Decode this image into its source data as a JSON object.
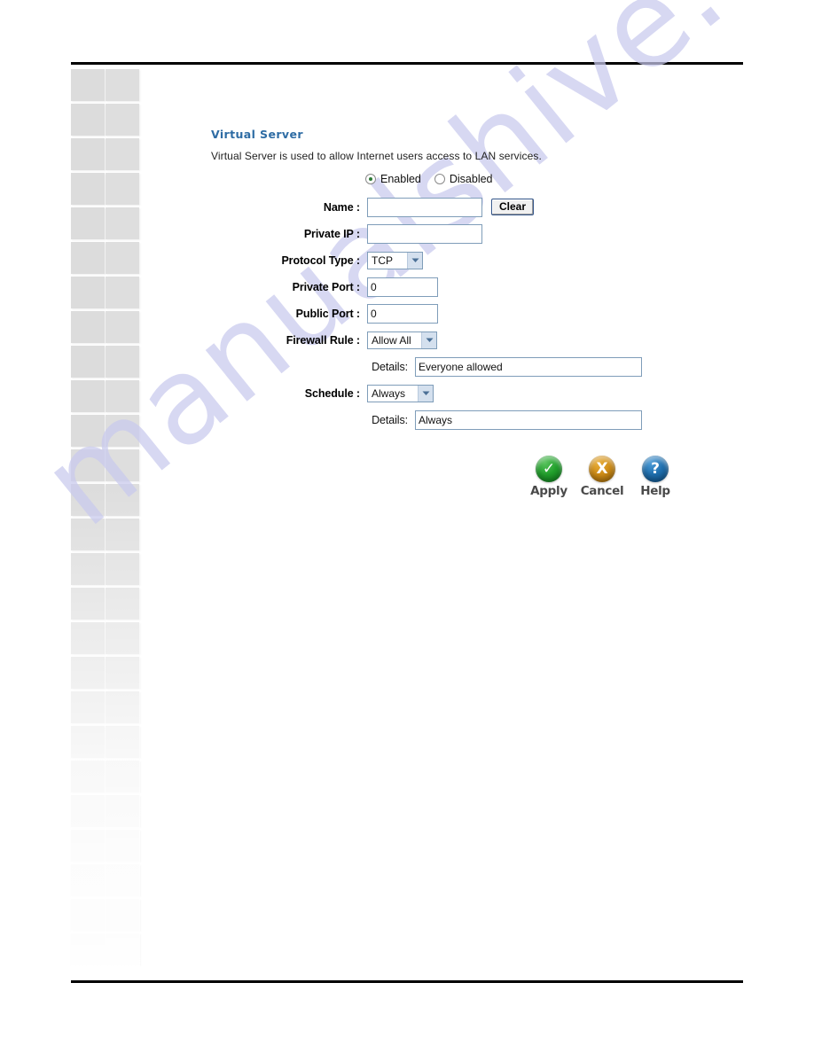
{
  "panel": {
    "title": "Virtual Server",
    "description": "Virtual Server is used to allow Internet users access to LAN services."
  },
  "enable": {
    "enabled_label": "Enabled",
    "disabled_label": "Disabled",
    "selected": "Enabled"
  },
  "fields": {
    "name": {
      "label": "Name :",
      "value": "",
      "clear_label": "Clear"
    },
    "private_ip": {
      "label": "Private IP :",
      "value": ""
    },
    "protocol_type": {
      "label": "Protocol Type :",
      "value": "TCP"
    },
    "private_port": {
      "label": "Private Port :",
      "value": "0"
    },
    "public_port": {
      "label": "Public Port :",
      "value": "0"
    },
    "firewall_rule": {
      "label": "Firewall Rule :",
      "value": "Allow All",
      "details_label": "Details:",
      "details_value": "Everyone allowed"
    },
    "schedule": {
      "label": "Schedule :",
      "value": "Always",
      "details_label": "Details:",
      "details_value": "Always"
    }
  },
  "actions": {
    "apply": {
      "label": "Apply",
      "glyph": "✓",
      "color": "#22a02c"
    },
    "cancel": {
      "label": "Cancel",
      "glyph": "X",
      "color": "#cf8c16"
    },
    "help": {
      "label": "Help",
      "glyph": "?",
      "color": "#1f6fae"
    }
  },
  "watermark": {
    "text": "manualshive.com",
    "color": "#c9caee"
  },
  "colors": {
    "heading": "#2e6ca4",
    "input_border": "#7f9db9",
    "rule": "#000000"
  }
}
